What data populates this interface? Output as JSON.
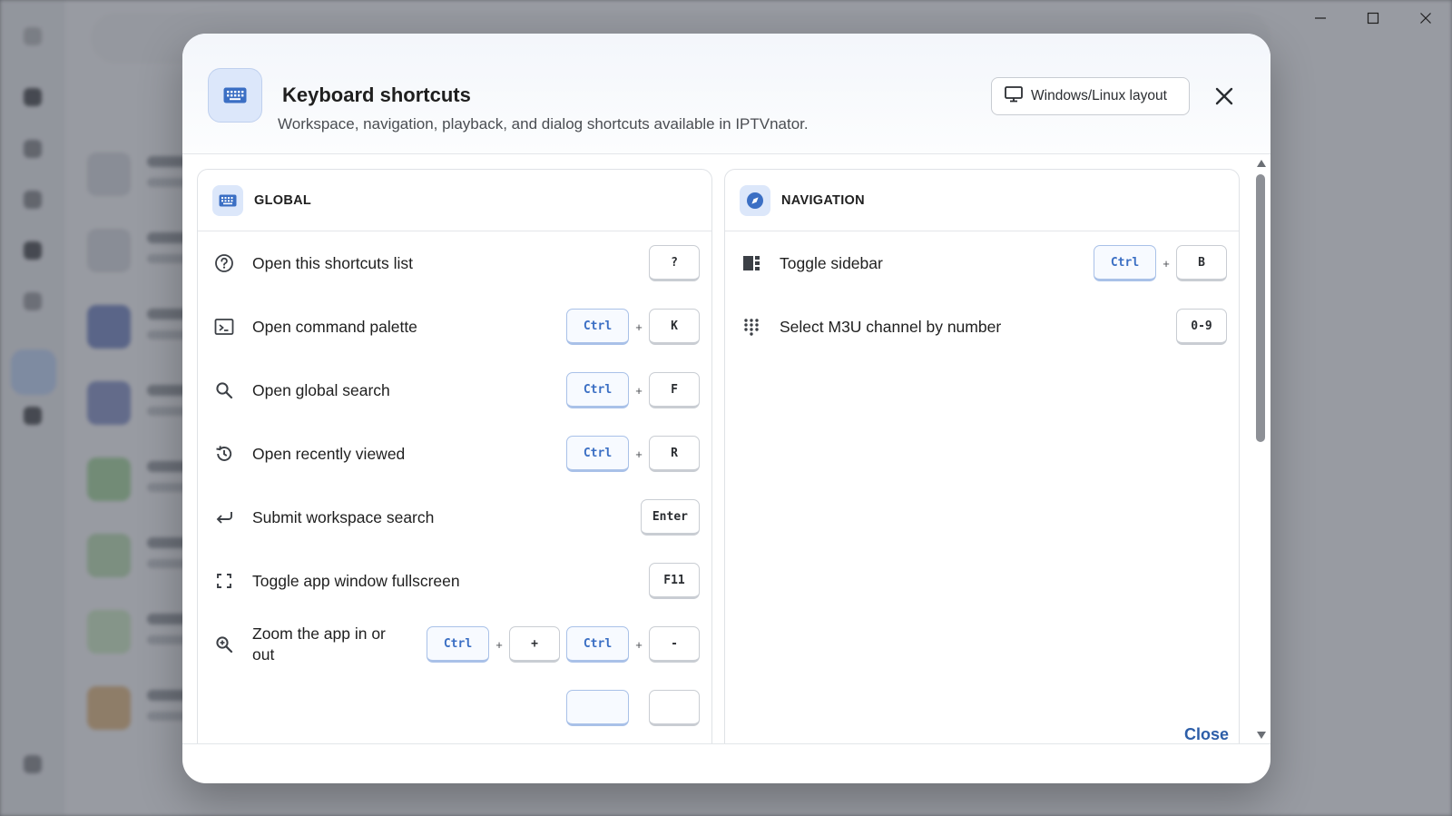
{
  "dialog": {
    "title": "Keyboard shortcuts",
    "subtitle": "Workspace, navigation, playback, and dialog shortcuts available in IPTVnator.",
    "layout_button": {
      "label": "Windows/Linux layout",
      "icon": "monitor-icon"
    },
    "close_label": "Close"
  },
  "categories": {
    "global": {
      "title": "GLOBAL",
      "icon": "keyboard-icon",
      "shortcuts": [
        {
          "label": "Open this shortcuts list",
          "icon": "help-circle-icon",
          "keys": [
            "?"
          ]
        },
        {
          "label": "Open command palette",
          "icon": "terminal-icon",
          "keys": [
            "Ctrl",
            "+",
            "K"
          ]
        },
        {
          "label": "Open global search",
          "icon": "search-icon",
          "keys": [
            "Ctrl",
            "+",
            "F"
          ]
        },
        {
          "label": "Open recently viewed",
          "icon": "history-icon",
          "keys": [
            "Ctrl",
            "+",
            "R"
          ]
        },
        {
          "label": "Submit workspace search",
          "icon": "enter-arrow-icon",
          "keys": [
            "Enter"
          ]
        },
        {
          "label": "Toggle app window fullscreen",
          "icon": "fullscreen-icon",
          "keys": [
            "F11"
          ]
        },
        {
          "label": "Zoom the app in or out",
          "icon": "zoom-in-icon",
          "keys": [
            "Ctrl",
            "+",
            "+",
            "Ctrl",
            "+",
            "-"
          ]
        }
      ]
    },
    "navigation": {
      "title": "NAVIGATION",
      "icon": "compass-icon",
      "shortcuts": [
        {
          "label": "Toggle sidebar",
          "icon": "sidebar-icon",
          "keys": [
            "Ctrl",
            "+",
            "B"
          ]
        },
        {
          "label": "Select M3U channel by number",
          "icon": "dialpad-icon",
          "keys": [
            "0-9"
          ]
        }
      ]
    }
  },
  "colors": {
    "accent": "#3b6fc4",
    "accent_bg": "#dce7fa",
    "close_text": "#2d5ea8"
  }
}
